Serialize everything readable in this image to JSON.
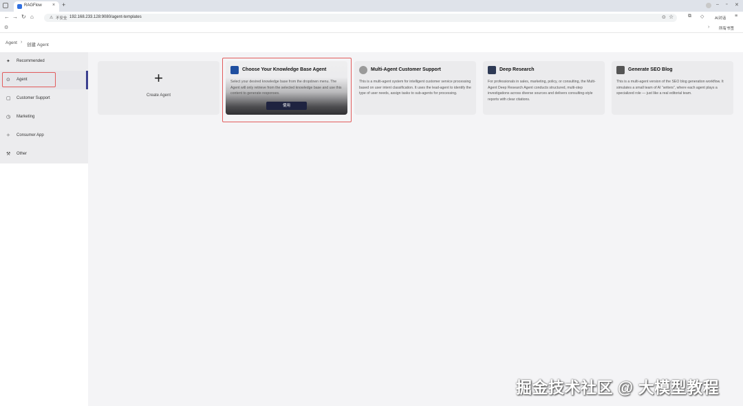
{
  "browser": {
    "tab_title": "RAGFlow",
    "tab_close": "×",
    "new_tab": "+",
    "url_warning": "不安全",
    "url": "192.168.233.128:9080/agent-templates",
    "ai_label": "AI对话",
    "bookmarks_all": "所有书签",
    "icons": [
      "tab-grid-icon",
      "back-icon",
      "forward-icon",
      "reload-icon",
      "home-icon",
      "location-icon",
      "star-icon",
      "extensions-icon",
      "sidebar-icon",
      "menu-icon"
    ]
  },
  "breadcrumb": {
    "root": "Agent",
    "separator": "›",
    "current": "创建 Agent"
  },
  "sidebar": {
    "items": [
      {
        "label": "Recommended",
        "icon": "sparkle-icon",
        "glyph": "✦"
      },
      {
        "label": "Agent",
        "icon": "agent-icon",
        "glyph": "⊙"
      },
      {
        "label": "Customer Support",
        "icon": "support-icon",
        "glyph": "▢"
      },
      {
        "label": "Marketing",
        "icon": "marketing-icon",
        "glyph": "◷"
      },
      {
        "label": "Consumer App",
        "icon": "app-icon",
        "glyph": "✧"
      },
      {
        "label": "Other",
        "icon": "other-icon",
        "glyph": "⚒"
      }
    ],
    "active_index": 1
  },
  "cards": {
    "create": {
      "plus": "+",
      "label": "Create Agent"
    },
    "kb": {
      "title": "Choose Your Knowledge Base Agent",
      "description": "Select your desired knowledge base from the dropdown menu. The Agent will only retrieve from the selected knowledge base and use this content to generate responses.",
      "button": "使用",
      "icon_color": "#1f4fa0"
    },
    "support": {
      "title": "Multi-Agent Customer Support",
      "description": "This is a multi-agent system for intelligent customer service processing based on user intent classification. It uses the lead-agent to identify the type of user needs, assign tasks to sub-agents for processing.",
      "icon_color": "#9a9a9a"
    },
    "research": {
      "title": "Deep Research",
      "description": "For professionals in sales, marketing, policy, or consulting, the Multi-Agent Deep Research Agent conducts structured, multi-step investigations across diverse sources and delivers consulting-style reports with clear citations.",
      "icon_color": "#2e3a55"
    },
    "seo": {
      "title": "Generate SEO Blog",
      "description": "This is a multi-agent version of the SEO blog generation workflow. It simulates a small team of AI “writers”, where each agent plays a specialized role — just like a real editorial team.",
      "icon_color": "#555555"
    }
  },
  "watermark": "掘金技术社区 @ 大模型教程",
  "colors": {
    "highlight": "#e15b5b",
    "active_bar": "#3a3f8f",
    "use_button": "#1f2340"
  }
}
